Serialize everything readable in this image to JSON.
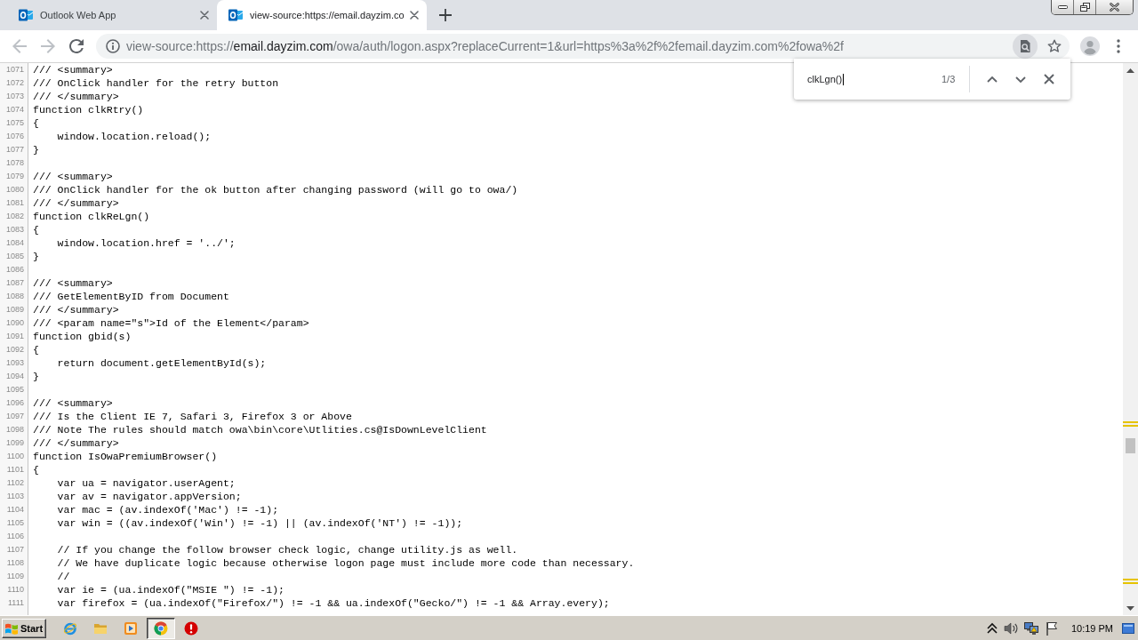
{
  "tabs": [
    {
      "title": "Outlook Web App",
      "selected": false
    },
    {
      "title": "view-source:https://email.dayzim.co",
      "selected": true
    }
  ],
  "address_bar": {
    "url": [
      {
        "text": "view-source:https://",
        "emphasized": false
      },
      {
        "text": "email.dayzim.com",
        "emphasized": true
      },
      {
        "text": "/owa/auth/logon.aspx?replaceCurrent=1&url=https%3a%2f%2femail.dayzim.com%2fowa%2f",
        "emphasized": false
      }
    ]
  },
  "find_bar": {
    "query": "clkLgn()",
    "match_count": "1/3"
  },
  "source": {
    "lines": [
      {
        "number": "1071",
        "code": "/// <summary>"
      },
      {
        "number": "1072",
        "code": "/// OnClick handler for the retry button"
      },
      {
        "number": "1073",
        "code": "/// </summary>"
      },
      {
        "number": "1074",
        "code": "function clkRtry()"
      },
      {
        "number": "1075",
        "code": "{"
      },
      {
        "number": "1076",
        "code": "    window.location.reload();"
      },
      {
        "number": "1077",
        "code": "}"
      },
      {
        "number": "1078"
      },
      {
        "number": "1079",
        "code": "/// <summary>"
      },
      {
        "number": "1080",
        "code": "/// OnClick handler for the ok button after changing password (will go to owa/)"
      },
      {
        "number": "1081",
        "code": "/// </summary>"
      },
      {
        "number": "1082",
        "code": "function clkReLgn()"
      },
      {
        "number": "1083",
        "code": "{"
      },
      {
        "number": "1084",
        "code": "    window.location.href = '../';"
      },
      {
        "number": "1085",
        "code": "}"
      },
      {
        "number": "1086"
      },
      {
        "number": "1087",
        "code": "/// <summary>"
      },
      {
        "number": "1088",
        "code": "/// GetElementByID from Document"
      },
      {
        "number": "1089",
        "code": "/// </summary>"
      },
      {
        "number": "1090",
        "code": "/// <param name=\"s\">Id of the Element</param>"
      },
      {
        "number": "1091",
        "code": "function gbid(s)"
      },
      {
        "number": "1092",
        "code": "{"
      },
      {
        "number": "1093",
        "code": "    return document.getElementById(s);"
      },
      {
        "number": "1094",
        "code": "}"
      },
      {
        "number": "1095"
      },
      {
        "number": "1096",
        "code": "/// <summary>"
      },
      {
        "number": "1097",
        "code": "/// Is the Client IE 7, Safari 3, Firefox 3 or Above"
      },
      {
        "number": "1098",
        "code": "/// Note The rules should match owa\\bin\\core\\Utlities.cs@IsDownLevelClient"
      },
      {
        "number": "1099",
        "code": "/// </summary>"
      },
      {
        "number": "1100",
        "code": "function IsOwaPremiumBrowser()"
      },
      {
        "number": "1101",
        "code": "{"
      },
      {
        "number": "1102",
        "code": "    var ua = navigator.userAgent;"
      },
      {
        "number": "1103",
        "code": "    var av = navigator.appVersion;"
      },
      {
        "number": "1104",
        "code": "    var mac = (av.indexOf('Mac') != -1);"
      },
      {
        "number": "1105",
        "code": "    var win = ((av.indexOf('Win') != -1) || (av.indexOf('NT') != -1));"
      },
      {
        "number": "1106"
      },
      {
        "number": "1107",
        "code": "    // If you change the follow browser check logic, change utility.js as well."
      },
      {
        "number": "1108",
        "code": "    // We have duplicate logic because otherwise logon page must include more code than necessary."
      },
      {
        "number": "1109",
        "code": "    //"
      },
      {
        "number": "1110",
        "code": "    var ie = (ua.indexOf(\"MSIE \") != -1);"
      },
      {
        "number": "1111",
        "code": "    var firefox = (ua.indexOf(\"Firefox/\") != -1 && ua.indexOf(\"Gecko/\") != -1 && Array.every);"
      }
    ]
  },
  "taskbar": {
    "start": "Start",
    "apps": [
      {
        "selected": false
      },
      {
        "selected": false
      },
      {
        "selected": false
      },
      {
        "selected": true
      },
      {
        "selected": false
      }
    ],
    "clock": "10:19 PM"
  }
}
